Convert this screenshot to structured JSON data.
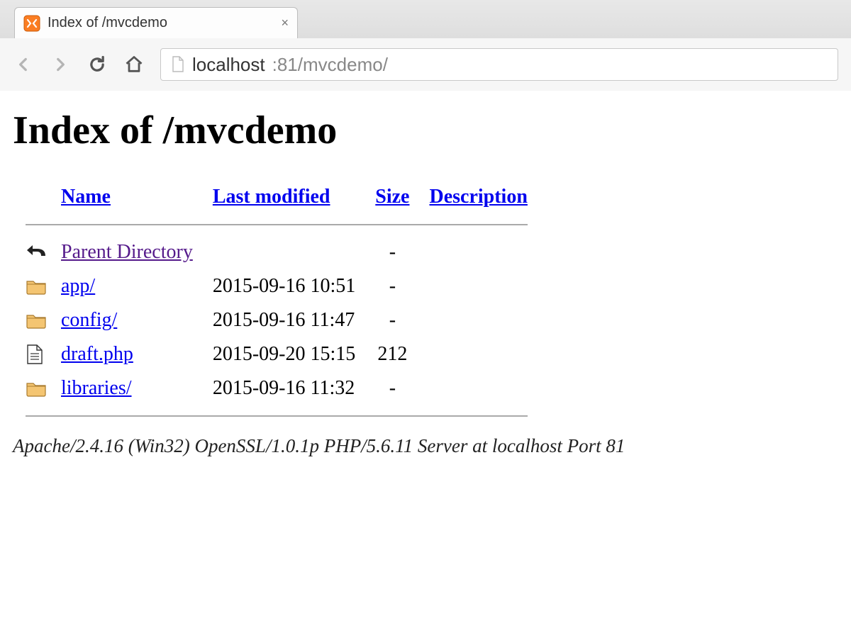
{
  "browser": {
    "tab_title": "Index of /mvcdemo",
    "url_display_host": "localhost",
    "url_display_port_path": ":81/mvcdemo/"
  },
  "page": {
    "heading": "Index of /mvcdemo",
    "columns": {
      "name": "Name",
      "modified": "Last modified",
      "size": "Size",
      "description": "Description"
    },
    "parent_label": "Parent Directory",
    "entries": [
      {
        "icon": "folder",
        "name": "app/",
        "modified": "2015-09-16 10:51",
        "size": "-",
        "desc": ""
      },
      {
        "icon": "folder",
        "name": "config/",
        "modified": "2015-09-16 11:47",
        "size": "-",
        "desc": ""
      },
      {
        "icon": "file",
        "name": "draft.php",
        "modified": "2015-09-20 15:15",
        "size": "212",
        "desc": ""
      },
      {
        "icon": "folder",
        "name": "libraries/",
        "modified": "2015-09-16 11:32",
        "size": "-",
        "desc": ""
      }
    ],
    "server_signature": "Apache/2.4.16 (Win32) OpenSSL/1.0.1p PHP/5.6.11 Server at localhost Port 81"
  }
}
